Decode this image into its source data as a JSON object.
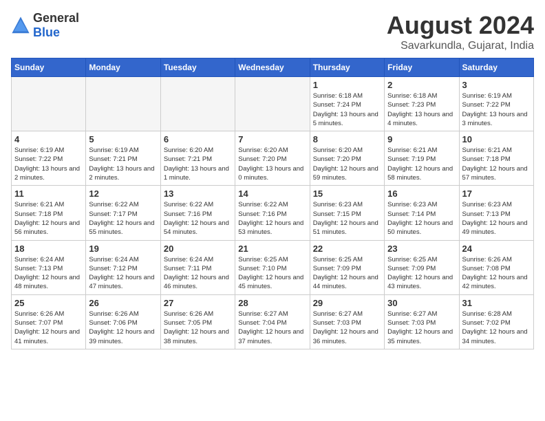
{
  "header": {
    "logo_general": "General",
    "logo_blue": "Blue",
    "title": "August 2024",
    "subtitle": "Savarkundla, Gujarat, India"
  },
  "days_of_week": [
    "Sunday",
    "Monday",
    "Tuesday",
    "Wednesday",
    "Thursday",
    "Friday",
    "Saturday"
  ],
  "weeks": [
    [
      {
        "day": "",
        "info": "",
        "empty": true
      },
      {
        "day": "",
        "info": "",
        "empty": true
      },
      {
        "day": "",
        "info": "",
        "empty": true
      },
      {
        "day": "",
        "info": "",
        "empty": true
      },
      {
        "day": "1",
        "info": "Sunrise: 6:18 AM\nSunset: 7:24 PM\nDaylight: 13 hours\nand 5 minutes."
      },
      {
        "day": "2",
        "info": "Sunrise: 6:18 AM\nSunset: 7:23 PM\nDaylight: 13 hours\nand 4 minutes."
      },
      {
        "day": "3",
        "info": "Sunrise: 6:19 AM\nSunset: 7:22 PM\nDaylight: 13 hours\nand 3 minutes."
      }
    ],
    [
      {
        "day": "4",
        "info": "Sunrise: 6:19 AM\nSunset: 7:22 PM\nDaylight: 13 hours\nand 2 minutes."
      },
      {
        "day": "5",
        "info": "Sunrise: 6:19 AM\nSunset: 7:21 PM\nDaylight: 13 hours\nand 2 minutes."
      },
      {
        "day": "6",
        "info": "Sunrise: 6:20 AM\nSunset: 7:21 PM\nDaylight: 13 hours\nand 1 minute."
      },
      {
        "day": "7",
        "info": "Sunrise: 6:20 AM\nSunset: 7:20 PM\nDaylight: 13 hours\nand 0 minutes."
      },
      {
        "day": "8",
        "info": "Sunrise: 6:20 AM\nSunset: 7:20 PM\nDaylight: 12 hours\nand 59 minutes."
      },
      {
        "day": "9",
        "info": "Sunrise: 6:21 AM\nSunset: 7:19 PM\nDaylight: 12 hours\nand 58 minutes."
      },
      {
        "day": "10",
        "info": "Sunrise: 6:21 AM\nSunset: 7:18 PM\nDaylight: 12 hours\nand 57 minutes."
      }
    ],
    [
      {
        "day": "11",
        "info": "Sunrise: 6:21 AM\nSunset: 7:18 PM\nDaylight: 12 hours\nand 56 minutes."
      },
      {
        "day": "12",
        "info": "Sunrise: 6:22 AM\nSunset: 7:17 PM\nDaylight: 12 hours\nand 55 minutes."
      },
      {
        "day": "13",
        "info": "Sunrise: 6:22 AM\nSunset: 7:16 PM\nDaylight: 12 hours\nand 54 minutes."
      },
      {
        "day": "14",
        "info": "Sunrise: 6:22 AM\nSunset: 7:16 PM\nDaylight: 12 hours\nand 53 minutes."
      },
      {
        "day": "15",
        "info": "Sunrise: 6:23 AM\nSunset: 7:15 PM\nDaylight: 12 hours\nand 51 minutes."
      },
      {
        "day": "16",
        "info": "Sunrise: 6:23 AM\nSunset: 7:14 PM\nDaylight: 12 hours\nand 50 minutes."
      },
      {
        "day": "17",
        "info": "Sunrise: 6:23 AM\nSunset: 7:13 PM\nDaylight: 12 hours\nand 49 minutes."
      }
    ],
    [
      {
        "day": "18",
        "info": "Sunrise: 6:24 AM\nSunset: 7:13 PM\nDaylight: 12 hours\nand 48 minutes."
      },
      {
        "day": "19",
        "info": "Sunrise: 6:24 AM\nSunset: 7:12 PM\nDaylight: 12 hours\nand 47 minutes."
      },
      {
        "day": "20",
        "info": "Sunrise: 6:24 AM\nSunset: 7:11 PM\nDaylight: 12 hours\nand 46 minutes."
      },
      {
        "day": "21",
        "info": "Sunrise: 6:25 AM\nSunset: 7:10 PM\nDaylight: 12 hours\nand 45 minutes."
      },
      {
        "day": "22",
        "info": "Sunrise: 6:25 AM\nSunset: 7:09 PM\nDaylight: 12 hours\nand 44 minutes."
      },
      {
        "day": "23",
        "info": "Sunrise: 6:25 AM\nSunset: 7:09 PM\nDaylight: 12 hours\nand 43 minutes."
      },
      {
        "day": "24",
        "info": "Sunrise: 6:26 AM\nSunset: 7:08 PM\nDaylight: 12 hours\nand 42 minutes."
      }
    ],
    [
      {
        "day": "25",
        "info": "Sunrise: 6:26 AM\nSunset: 7:07 PM\nDaylight: 12 hours\nand 41 minutes."
      },
      {
        "day": "26",
        "info": "Sunrise: 6:26 AM\nSunset: 7:06 PM\nDaylight: 12 hours\nand 39 minutes."
      },
      {
        "day": "27",
        "info": "Sunrise: 6:26 AM\nSunset: 7:05 PM\nDaylight: 12 hours\nand 38 minutes."
      },
      {
        "day": "28",
        "info": "Sunrise: 6:27 AM\nSunset: 7:04 PM\nDaylight: 12 hours\nand 37 minutes."
      },
      {
        "day": "29",
        "info": "Sunrise: 6:27 AM\nSunset: 7:03 PM\nDaylight: 12 hours\nand 36 minutes."
      },
      {
        "day": "30",
        "info": "Sunrise: 6:27 AM\nSunset: 7:03 PM\nDaylight: 12 hours\nand 35 minutes."
      },
      {
        "day": "31",
        "info": "Sunrise: 6:28 AM\nSunset: 7:02 PM\nDaylight: 12 hours\nand 34 minutes."
      }
    ]
  ]
}
